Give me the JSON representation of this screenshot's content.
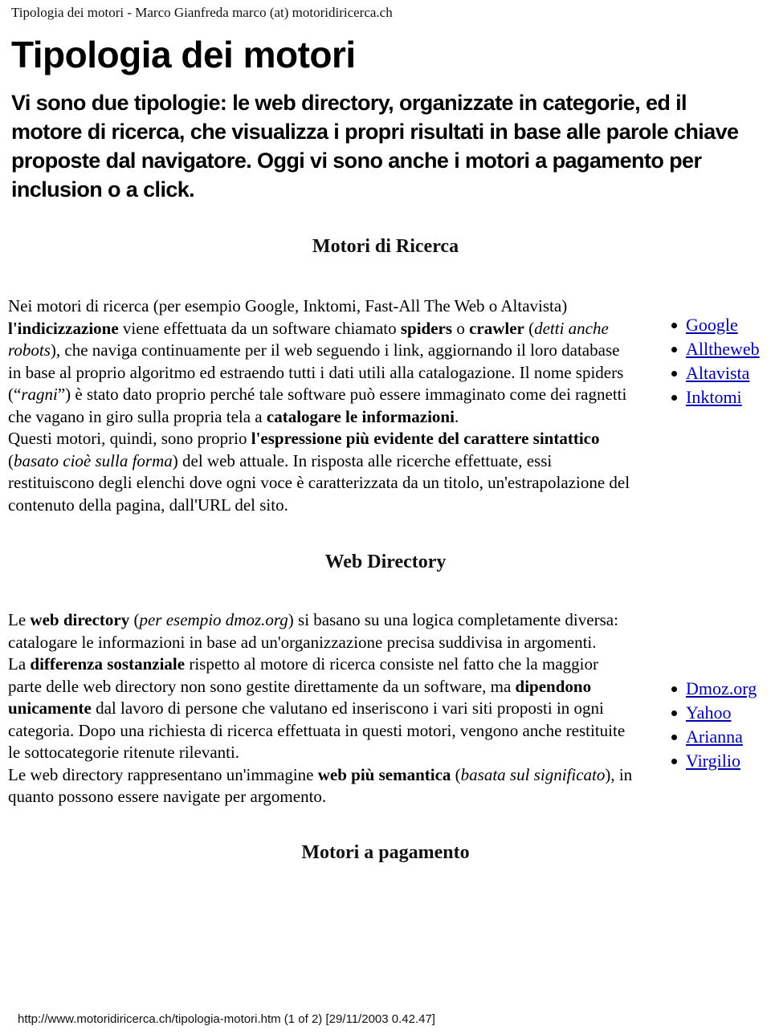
{
  "print_header": "Tipologia dei motori - Marco Gianfreda marco (at) motoridiricerca.ch",
  "document": {
    "title": "Tipologia dei motori",
    "intro": "Vi sono due tipologie: le web directory, organizzate in categorie, ed il motore di ricerca, che visualizza i propri risultati in base alle parole chiave proposte dal navigatore. Oggi vi sono anche i motori a pagamento per inclusion o a click."
  },
  "sections": [
    {
      "heading": "Motori di Ricerca",
      "paragraphs": [
        {
          "id": "motori-p1",
          "runs": [
            {
              "text": "Nei motori di ricerca (per esempio Google, Inktomi, Fast-All The Web o Altavista) ",
              "style": "normal"
            },
            {
              "text": "l'indicizzazione",
              "style": "bold"
            },
            {
              "text": " viene effettuata da un software chiamato ",
              "style": "normal"
            },
            {
              "text": "spiders",
              "style": "bold"
            },
            {
              "text": " o ",
              "style": "normal"
            },
            {
              "text": "crawler",
              "style": "bold"
            },
            {
              "text": " (",
              "style": "normal"
            },
            {
              "text": "detti anche robots",
              "style": "italic"
            },
            {
              "text": "), che naviga continuamente per il web seguendo i link, aggiornando il loro database in base al proprio algoritmo ed estraendo tutti i dati utili alla catalogazione. Il nome spiders (“",
              "style": "normal"
            },
            {
              "text": "ragni",
              "style": "italic"
            },
            {
              "text": "”) è stato dato proprio perché tale software può essere immaginato come dei ragnetti che vagano in giro sulla propria tela a ",
              "style": "normal"
            },
            {
              "text": "catalogare le informazioni",
              "style": "bold"
            },
            {
              "text": ".",
              "style": "normal"
            }
          ]
        },
        {
          "id": "motori-p2",
          "runs": [
            {
              "text": "Questi motori, quindi, sono proprio ",
              "style": "normal"
            },
            {
              "text": "l'espressione più evidente del carattere sintattico",
              "style": "bold"
            },
            {
              "text": " (",
              "style": "normal"
            },
            {
              "text": "basato cioè sulla forma",
              "style": "italic"
            },
            {
              "text": ") del web attuale. In risposta alle ricerche effettuate, essi restituiscono degli elenchi dove ogni voce è caratterizzata da un titolo, un'estrapolazione del contenuto della pagina, dall'URL del sito.",
              "style": "normal"
            }
          ]
        }
      ],
      "links": [
        {
          "label": "Google"
        },
        {
          "label": "Alltheweb"
        },
        {
          "label": "Altavista"
        },
        {
          "label": "Inktomi"
        }
      ]
    },
    {
      "heading": "Web Directory",
      "paragraphs": [
        {
          "id": "dir-p1",
          "runs": [
            {
              "text": "Le ",
              "style": "normal"
            },
            {
              "text": "web directory",
              "style": "bold"
            },
            {
              "text": " (",
              "style": "normal"
            },
            {
              "text": "per esempio dmoz.org",
              "style": "italic"
            },
            {
              "text": ") si basano su una logica completamente diversa: catalogare le informazioni in base ad un'organizzazione precisa suddivisa in argomenti.",
              "style": "normal"
            }
          ]
        },
        {
          "id": "dir-p2",
          "runs": [
            {
              "text": "La ",
              "style": "normal"
            },
            {
              "text": "differenza sostanziale",
              "style": "bold"
            },
            {
              "text": " rispetto al motore di ricerca consiste nel fatto che la maggior parte delle web directory non sono gestite direttamente da un software, ma ",
              "style": "normal"
            },
            {
              "text": "dipendono unicamente",
              "style": "bold"
            },
            {
              "text": " dal lavoro di persone che valutano ed inseriscono i vari siti proposti in ogni categoria. Dopo una richiesta di ricerca effettuata in questi motori, vengono anche restituite le sottocategorie ritenute rilevanti.",
              "style": "normal"
            }
          ]
        },
        {
          "id": "dir-p3",
          "runs": [
            {
              "text": "Le web directory rappresentano un'immagine ",
              "style": "normal"
            },
            {
              "text": "web più semantica",
              "style": "bold"
            },
            {
              "text": " (",
              "style": "normal"
            },
            {
              "text": "basata sul significato",
              "style": "italic"
            },
            {
              "text": "), in quanto possono essere navigate per argomento.",
              "style": "normal"
            }
          ]
        }
      ],
      "links": [
        {
          "label": "Dmoz.org"
        },
        {
          "label": "Yahoo"
        },
        {
          "label": "Arianna"
        },
        {
          "label": "Virgilio"
        }
      ]
    },
    {
      "heading": "Motori a pagamento",
      "paragraphs": [],
      "links": []
    }
  ],
  "print_footer": "http://www.motoridiricerca.ch/tipologia-motori.htm (1 of 2) [29/11/2003 0.42.47]",
  "colors": {
    "link": "#0000b0",
    "text": "#000000",
    "background": "#ffffff"
  }
}
